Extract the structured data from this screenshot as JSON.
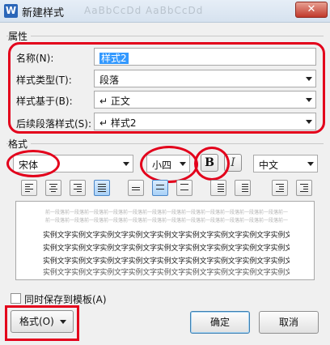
{
  "window": {
    "title": "新建样式",
    "app_icon_letter": "W",
    "faded_title_text": "AaBbCcDd  AaBbCcDd",
    "close_glyph": "✕"
  },
  "properties": {
    "group_label": "属性",
    "name_label": "名称(N):",
    "name_value": "样式2",
    "style_type_label": "样式类型(T):",
    "style_type_value": "段落",
    "based_on_label": "样式基于(B):",
    "based_on_value": "↵ 正文",
    "following_label": "后续段落样式(S):",
    "following_value": "↵ 样式2"
  },
  "format": {
    "group_label": "格式",
    "font_value": "宋体",
    "size_value": "小四",
    "bold_label": "B",
    "italic_label": "I",
    "language_value": "中文"
  },
  "preview": {
    "prev_paragraph": "前一段落前一段落前一段落前一段落前一段落前一段落前一段落前一段落前一段落前一段落前一段落前一段落前一段落",
    "sample_text": "实例文字实例文字实例文字实例文字实例文字实例文字实例文字实例文字实例文字实例文字实例文字"
  },
  "footer": {
    "save_to_template_label": "同时保存到模板(A)",
    "format_menu_label": "格式(O)",
    "ok_label": "确定",
    "cancel_label": "取消"
  },
  "colors": {
    "annotation": "#e3001b",
    "selection": "#3399ff"
  }
}
